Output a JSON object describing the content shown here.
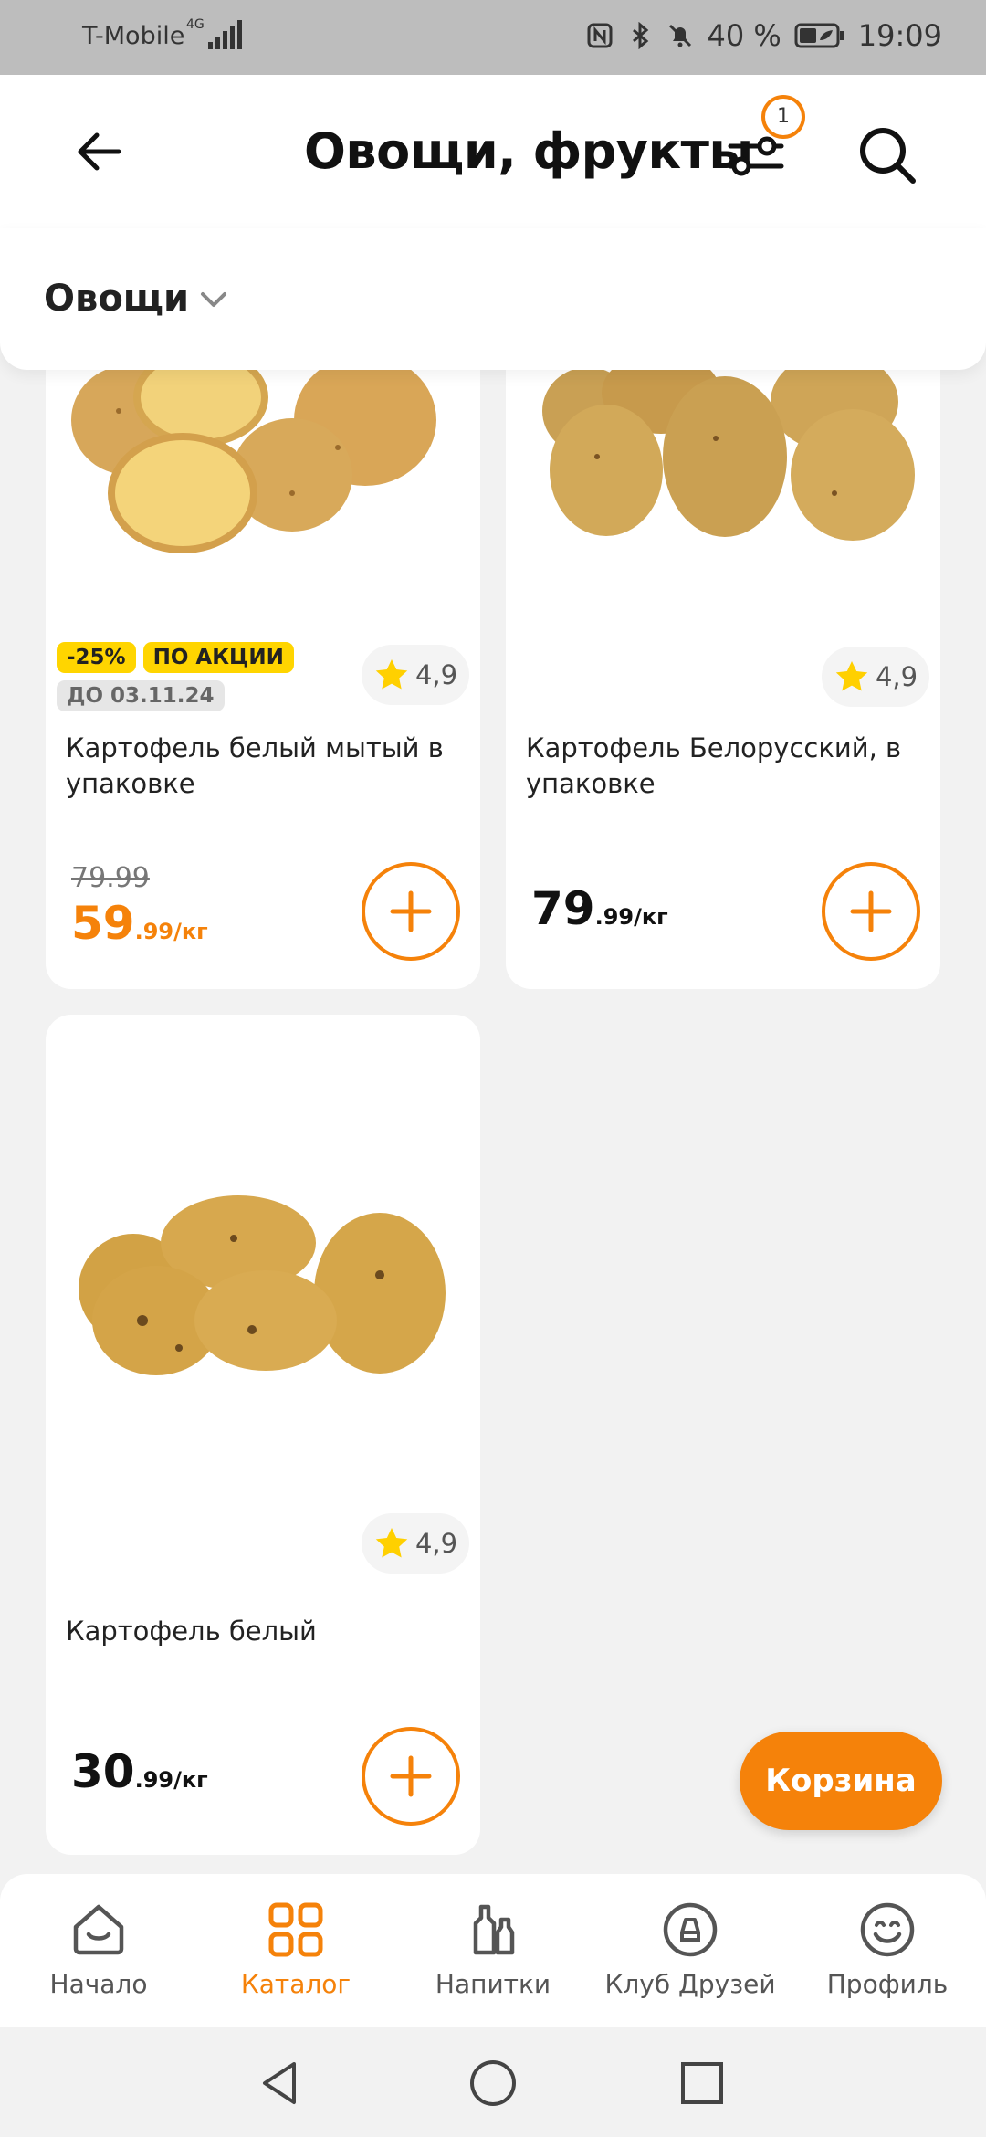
{
  "status_bar": {
    "carrier": "T-Mobile",
    "network": "4G",
    "battery": "40 %",
    "time": "19:09"
  },
  "header": {
    "title": "Овощи, фрукты",
    "filter_badge": "1"
  },
  "category": {
    "selected": "Овощи"
  },
  "products": [
    {
      "name": "Картофель белый мытый в упаковке",
      "rating": "4,9",
      "tags": [
        "-25%",
        "ПО АКЦИИ"
      ],
      "date_tag": "ДО 03.11.24",
      "old_price": "79.99",
      "price_main": "59",
      "price_fraction": ".99/кг"
    },
    {
      "name": "Картофель Белорусский, в упаковке",
      "rating": "4,9",
      "price_main": "79",
      "price_fraction": ".99/кг"
    },
    {
      "name": "Картофель белый",
      "rating": "4,9",
      "price_main": "30",
      "price_fraction": ".99/кг"
    }
  ],
  "cart_button": "Корзина",
  "bottom_nav": [
    {
      "label": "Начало",
      "icon": "home-icon",
      "active": false
    },
    {
      "label": "Каталог",
      "icon": "catalog-grid-icon",
      "active": true
    },
    {
      "label": "Напитки",
      "icon": "bottles-icon",
      "active": false
    },
    {
      "label": "Клуб Друзей",
      "icon": "club-d-icon",
      "active": false
    },
    {
      "label": "Профиль",
      "icon": "smiley-icon",
      "active": false
    }
  ],
  "colors": {
    "accent": "#f5820a",
    "promo_yellow": "#ffd500"
  }
}
